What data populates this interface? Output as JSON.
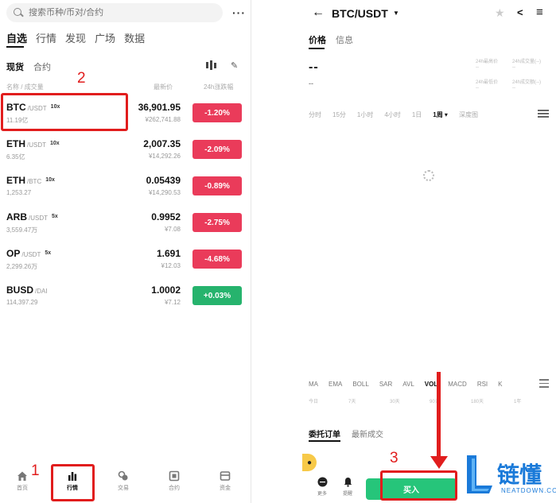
{
  "left": {
    "search": {
      "placeholder": "搜索币种/币对/合约"
    },
    "more": "···",
    "top_tabs": [
      "自选",
      "行情",
      "发现",
      "广场",
      "数据"
    ],
    "sub_tabs": [
      "现货",
      "合约"
    ],
    "columns": {
      "name": "名称 / 成交量",
      "last_price": "最新价",
      "change": "24h涨跌幅"
    },
    "rows": [
      {
        "symbol": "BTC",
        "quote": "/USDT",
        "leverage": "10x",
        "volume": "11.19亿",
        "price": "36,901.95",
        "cny": "¥262,741.88",
        "change": "-1.20%",
        "direction": "down"
      },
      {
        "symbol": "ETH",
        "quote": "/USDT",
        "leverage": "10x",
        "volume": "6.35亿",
        "price": "2,007.35",
        "cny": "¥14,292.26",
        "change": "-2.09%",
        "direction": "down"
      },
      {
        "symbol": "ETH",
        "quote": "/BTC",
        "leverage": "10x",
        "volume": "1,253.27",
        "price": "0.05439",
        "cny": "¥14,290.53",
        "change": "-0.89%",
        "direction": "down"
      },
      {
        "symbol": "ARB",
        "quote": "/USDT",
        "leverage": "5x",
        "volume": "3,559.47万",
        "price": "0.9952",
        "cny": "¥7.08",
        "change": "-2.75%",
        "direction": "down"
      },
      {
        "symbol": "OP",
        "quote": "/USDT",
        "leverage": "5x",
        "volume": "2,299.26万",
        "price": "1.691",
        "cny": "¥12.03",
        "change": "-4.68%",
        "direction": "down"
      },
      {
        "symbol": "BUSD",
        "quote": "/DAI",
        "leverage": "",
        "volume": "114,397.29",
        "price": "1.0002",
        "cny": "¥7.12",
        "change": "+0.03%",
        "direction": "up"
      }
    ],
    "bottom_nav": [
      {
        "label": "首页",
        "icon": "home-icon"
      },
      {
        "label": "行情",
        "icon": "chart-bars-icon"
      },
      {
        "label": "交易",
        "icon": "exchange-icon"
      },
      {
        "label": "合约",
        "icon": "contract-icon"
      },
      {
        "label": "资金",
        "icon": "wallet-icon"
      }
    ]
  },
  "right": {
    "back": "←",
    "pair": "BTC/USDT",
    "caret": "▼",
    "tabs": [
      "价格",
      "信息"
    ],
    "price": "--",
    "price_sub": "--",
    "stats": [
      "24h最高价",
      "24h成交量(--)",
      "24h最低价",
      "24h成交额(--)",
      "--",
      "--",
      "--",
      "--"
    ],
    "timeframes": [
      "分时",
      "15分",
      "1小时",
      "4小时",
      "1日",
      "1周 ▾",
      "深度图"
    ],
    "indicators": [
      "MA",
      "EMA",
      "BOLL",
      "SAR",
      "AVL",
      "VOL",
      "MACD",
      "RSI",
      "K"
    ],
    "indicator_sub": [
      "今日",
      "7天",
      "30天",
      "90天",
      "180天",
      "1年"
    ],
    "order_tabs": [
      "委托订单",
      "最新成交"
    ],
    "bottom_actions": [
      {
        "label": "更多",
        "icon": "more-circle-icon"
      },
      {
        "label": "提醒",
        "icon": "bell-icon"
      }
    ],
    "buy_label": "买入"
  },
  "annotations": {
    "step1": "1",
    "step2": "2",
    "step3": "3",
    "color": "#e11d1d"
  },
  "watermark": {
    "text": "链懂",
    "sub": "NEATDOWN.COM",
    "letter": "L"
  },
  "colors": {
    "down": "#ea3b5a",
    "up": "#26b36d",
    "buy": "#26c57a"
  }
}
